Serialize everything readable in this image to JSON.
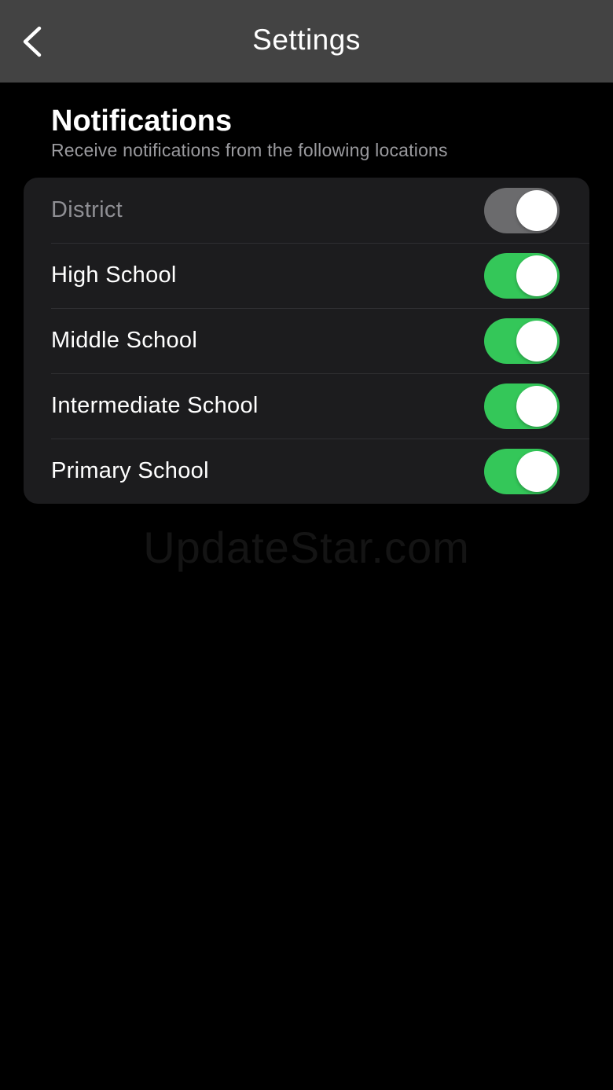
{
  "header": {
    "title": "Settings",
    "back_icon": "chevron-left-icon"
  },
  "notifications": {
    "title": "Notifications",
    "subtitle": "Receive notifications from the following locations",
    "items": [
      {
        "label": "District",
        "enabled": true,
        "disabled": true
      },
      {
        "label": "High School",
        "enabled": true,
        "disabled": false
      },
      {
        "label": "Middle School",
        "enabled": true,
        "disabled": false
      },
      {
        "label": "Intermediate School",
        "enabled": true,
        "disabled": false
      },
      {
        "label": "Primary School",
        "enabled": true,
        "disabled": false
      }
    ]
  },
  "watermark": "UpdateStar.com",
  "colors": {
    "toggle_on": "#34c759",
    "toggle_disabled": "#6b6b6d",
    "nav_background": "#434343",
    "card_background": "#1c1c1e"
  }
}
